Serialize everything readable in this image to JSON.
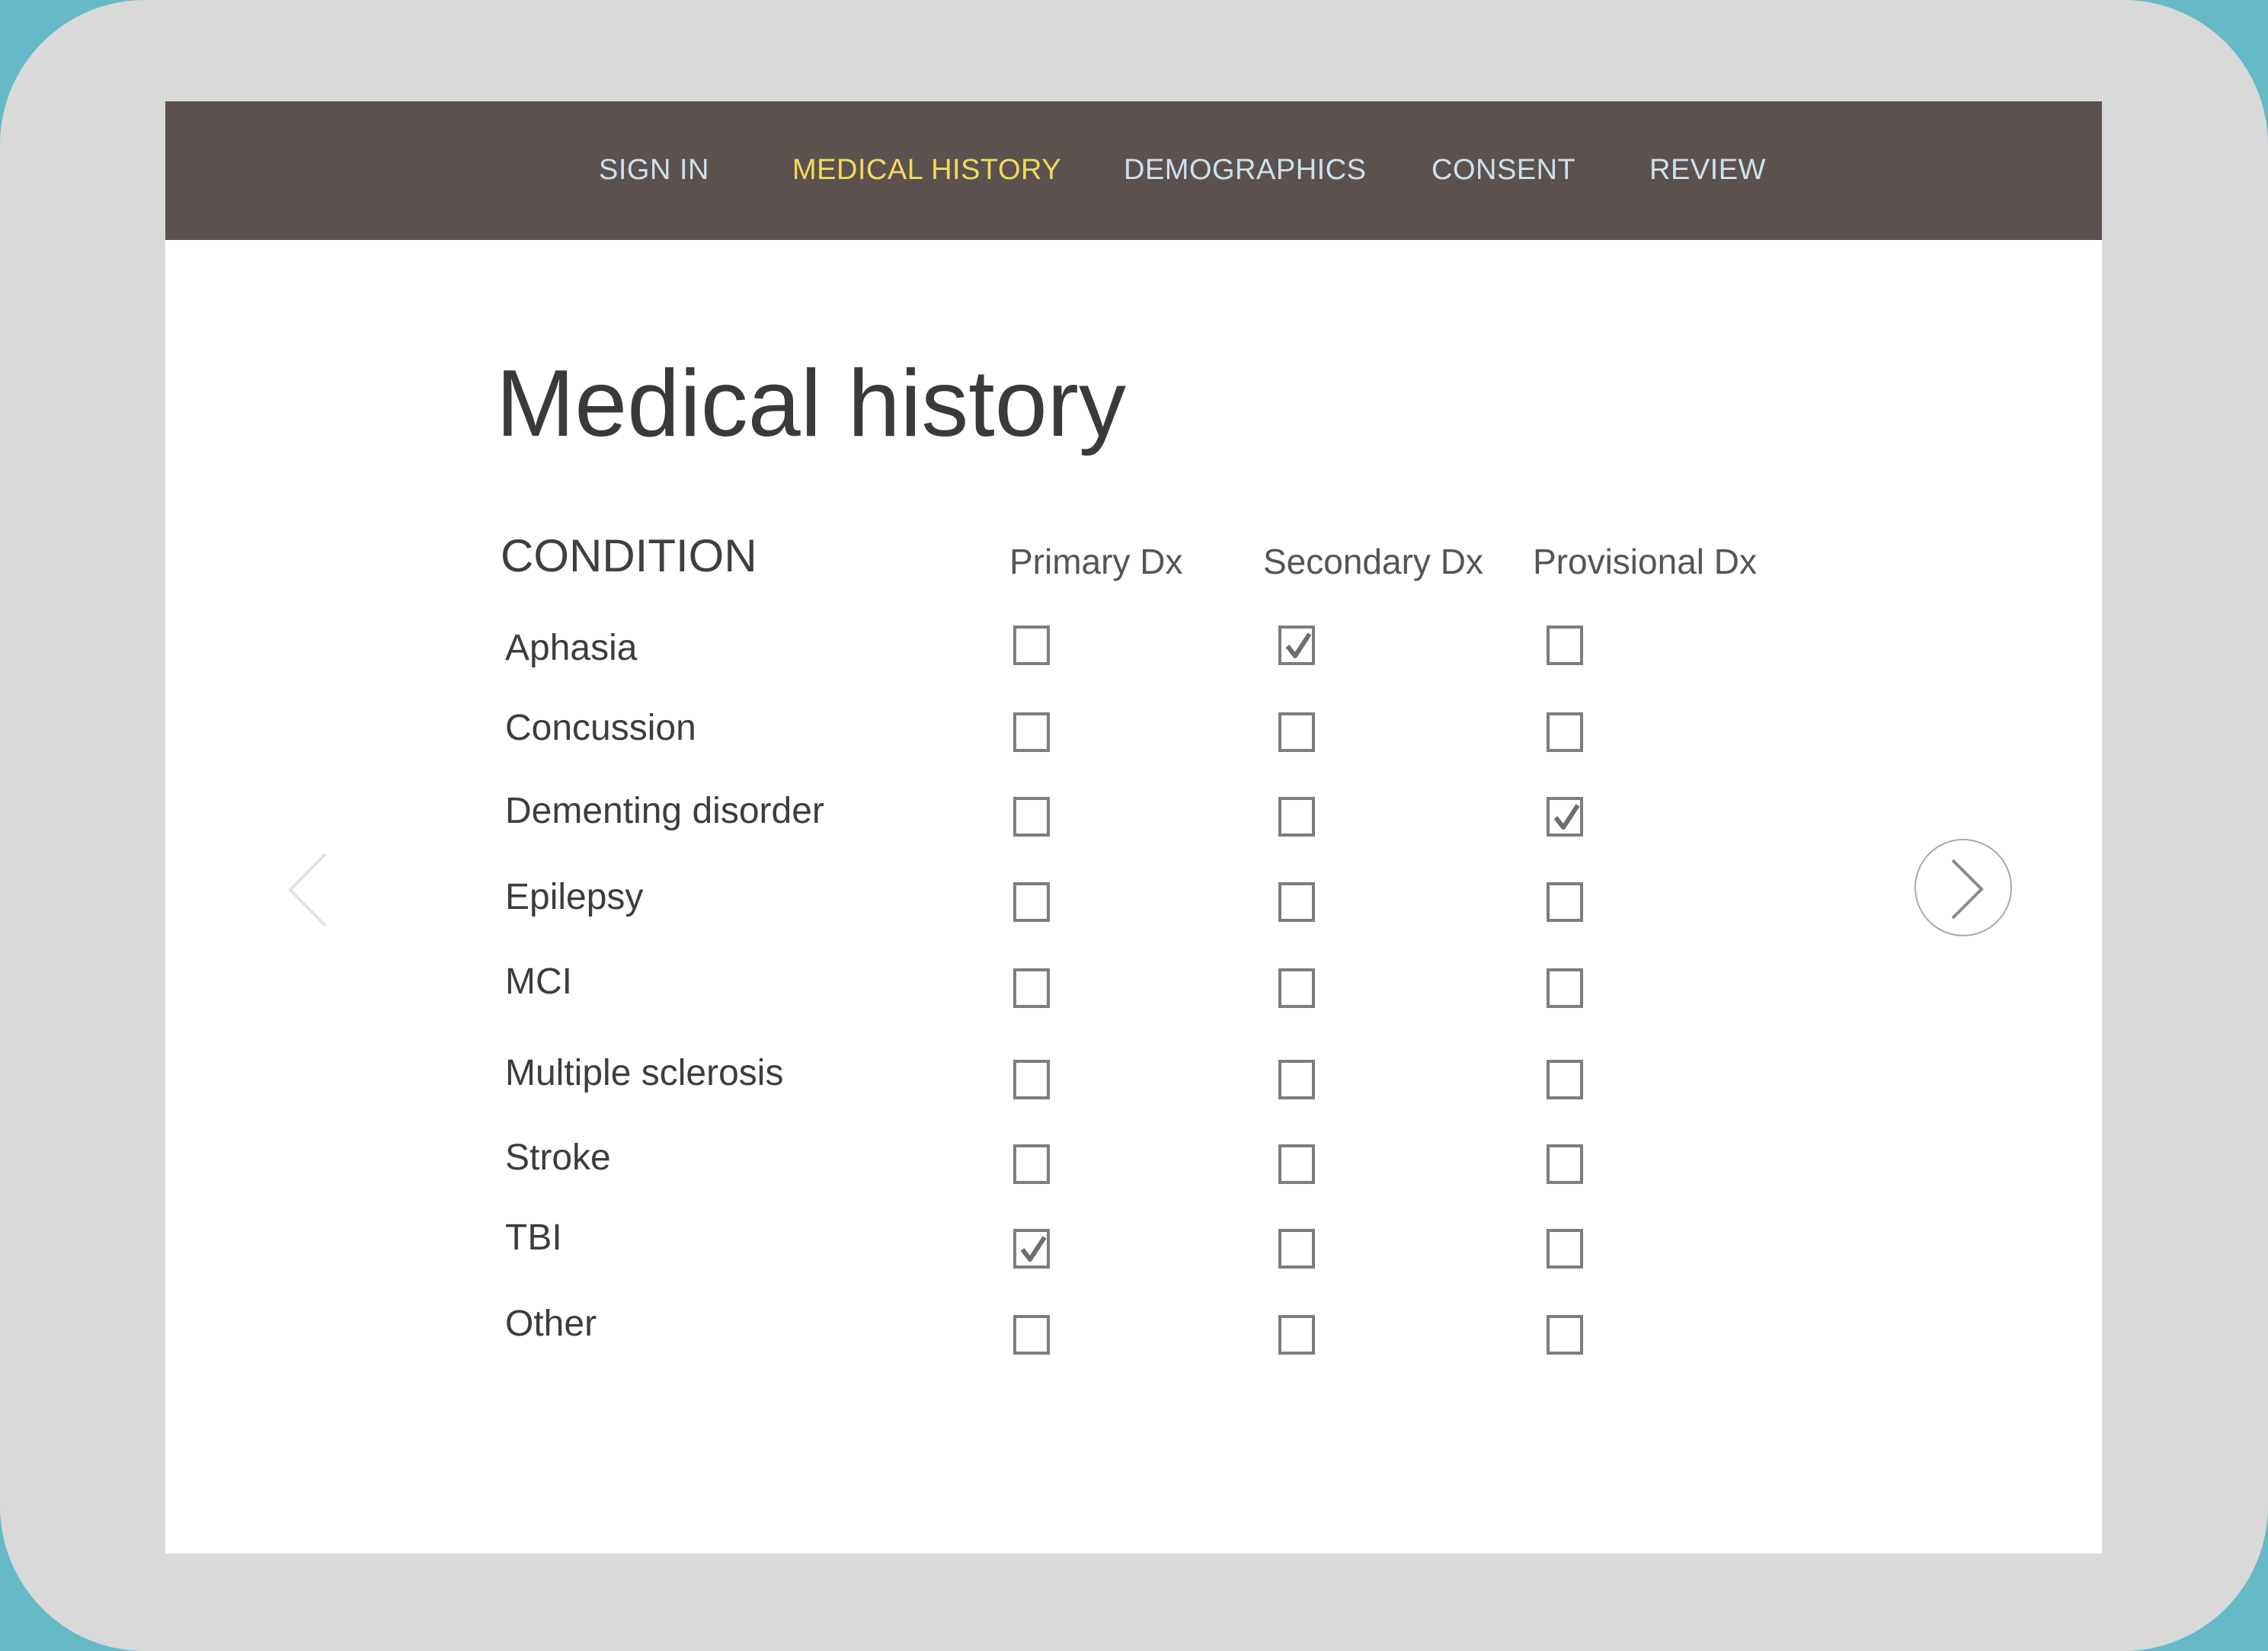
{
  "nav": {
    "items": [
      {
        "label": "SIGN IN",
        "active": false
      },
      {
        "label": "MEDICAL HISTORY",
        "active": true
      },
      {
        "label": "DEMOGRAPHICS",
        "active": false
      },
      {
        "label": "CONSENT",
        "active": false
      },
      {
        "label": "REVIEW",
        "active": false
      }
    ]
  },
  "page": {
    "title": "Medical history"
  },
  "table": {
    "condition_header": "CONDITION",
    "columns": [
      "Primary Dx",
      "Secondary Dx",
      "Provisional Dx"
    ],
    "rows": [
      {
        "label": "Aphasia",
        "checked": [
          false,
          true,
          false
        ]
      },
      {
        "label": "Concussion",
        "checked": [
          false,
          false,
          false
        ]
      },
      {
        "label": "Dementing disorder",
        "checked": [
          false,
          false,
          true
        ]
      },
      {
        "label": "Epilepsy",
        "checked": [
          false,
          false,
          false
        ]
      },
      {
        "label": "MCI",
        "checked": [
          false,
          false,
          false
        ]
      },
      {
        "label": "Multiple sclerosis",
        "checked": [
          false,
          false,
          false
        ]
      },
      {
        "label": "Stroke",
        "checked": [
          false,
          false,
          false
        ]
      },
      {
        "label": "TBI",
        "checked": [
          true,
          false,
          false
        ]
      },
      {
        "label": "Other",
        "checked": [
          false,
          false,
          false
        ]
      }
    ]
  },
  "pager": {
    "prev_icon": "chevron-left-icon",
    "next_icon": "chevron-right-icon"
  },
  "colors": {
    "navbar": "#5b5250",
    "nav_text": "#cfe0ec",
    "nav_active": "#f1db5a",
    "frame": "#d9d9d9",
    "outer_background": "#66b9c6"
  }
}
